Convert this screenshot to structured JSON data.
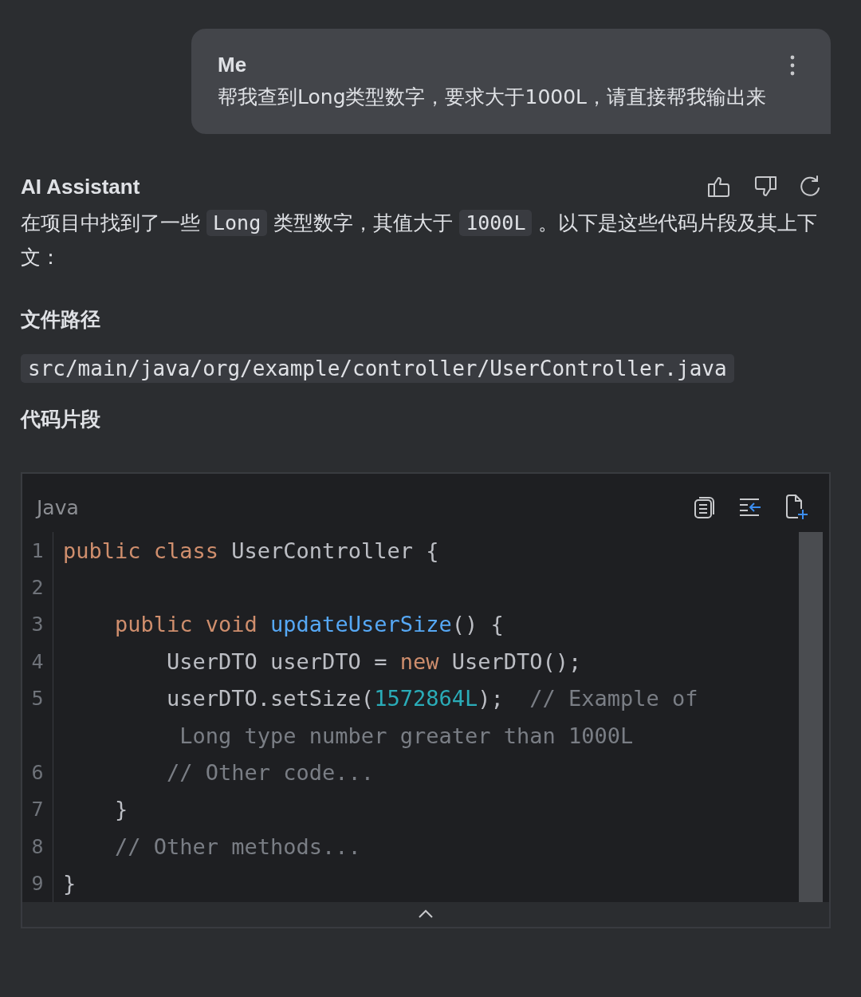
{
  "user_message": {
    "author": "Me",
    "text": "帮我查到Long类型数字，要求大于1000L，请直接帮我输出来"
  },
  "assistant": {
    "author": "AI Assistant",
    "paragraph": [
      {
        "kind": "text",
        "text": "在项目中找到了一些"
      },
      {
        "kind": "code",
        "text": "Long"
      },
      {
        "kind": "text",
        "text": "类型数字，其值大于"
      },
      {
        "kind": "code",
        "text": "1000L"
      },
      {
        "kind": "text",
        "text": "。以下是这些代码片段及其上下文："
      }
    ],
    "sections": [
      {
        "kind": "heading",
        "text": "文件路径"
      },
      {
        "kind": "path",
        "text": "src/main/java/org/example/controller/UserController.java"
      },
      {
        "kind": "heading",
        "text": "代码片段"
      }
    ],
    "code_block": {
      "language": "Java",
      "lines": [
        {
          "number": "1",
          "tokens": [
            {
              "kind": "keyword",
              "text": "public class"
            },
            {
              "kind": "plain",
              "text": " UserController {"
            }
          ]
        },
        {
          "number": "2"
        },
        {
          "number": "3",
          "tokens": [
            {
              "kind": "keyword",
              "text": "    public void"
            },
            {
              "kind": "method",
              "text": " updateUserSize"
            },
            {
              "kind": "plain",
              "text": "() {"
            }
          ]
        },
        {
          "number": "4",
          "tokens": [
            {
              "kind": "plain",
              "text": "        UserDTO userDTO = "
            },
            {
              "kind": "keyword",
              "text": "new"
            },
            {
              "kind": "plain",
              "text": " UserDTO();"
            }
          ]
        },
        {
          "number": "5",
          "tokens": [
            {
              "kind": "plain",
              "text": "        userDTO.setSize("
            },
            {
              "kind": "number",
              "text": "1572864L"
            },
            {
              "kind": "plain",
              "text": ");  "
            },
            {
              "kind": "comment",
              "text": "// Example of"
            }
          ]
        },
        {
          "tokens": [
            {
              "kind": "comment",
              "text": "         Long type number greater than 1000L"
            }
          ]
        },
        {
          "number": "6",
          "tokens": [
            {
              "kind": "comment",
              "text": "        // Other code..."
            }
          ]
        },
        {
          "number": "7",
          "tokens": [
            {
              "kind": "plain",
              "text": "    }"
            }
          ]
        },
        {
          "number": "8",
          "tokens": [
            {
              "kind": "comment",
              "text": "    // Other methods..."
            }
          ]
        },
        {
          "number": "9",
          "tokens": [
            {
              "kind": "plain",
              "text": "}"
            }
          ]
        }
      ]
    }
  }
}
